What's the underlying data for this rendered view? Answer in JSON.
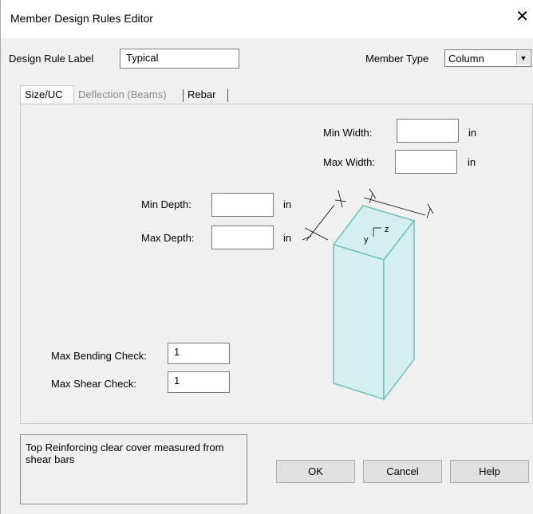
{
  "window": {
    "title": "Member Design Rules Editor",
    "close_glyph": "✕"
  },
  "design_rule": {
    "label": "Design Rule Label",
    "value": "Typical"
  },
  "member_type": {
    "label": "Member Type",
    "value": "Column"
  },
  "tabs": [
    {
      "label": "Size/UC",
      "state": "active"
    },
    {
      "label": "Deflection (Beams)",
      "state": "disabled"
    },
    {
      "label": "Rebar",
      "state": "normal"
    }
  ],
  "size": {
    "min_width": {
      "label": "Min Width:",
      "value": "",
      "unit": "in"
    },
    "max_width": {
      "label": "Max Width:",
      "value": "",
      "unit": "in"
    },
    "min_depth": {
      "label": "Min Depth:",
      "value": "",
      "unit": "in"
    },
    "max_depth": {
      "label": "Max Depth:",
      "value": "",
      "unit": "in"
    }
  },
  "checks": {
    "bending": {
      "label": "Max Bending Check:",
      "value": "1"
    },
    "shear": {
      "label": "Max Shear Check:",
      "value": "1"
    }
  },
  "diagram": {
    "axis_y": "y",
    "axis_z": "z",
    "fill_color": "#d4efee",
    "stroke_color": "#6ec0c0"
  },
  "help_text": "Top Reinforcing clear cover measured from shear bars",
  "buttons": {
    "ok": "OK",
    "cancel": "Cancel",
    "help": "Help"
  }
}
